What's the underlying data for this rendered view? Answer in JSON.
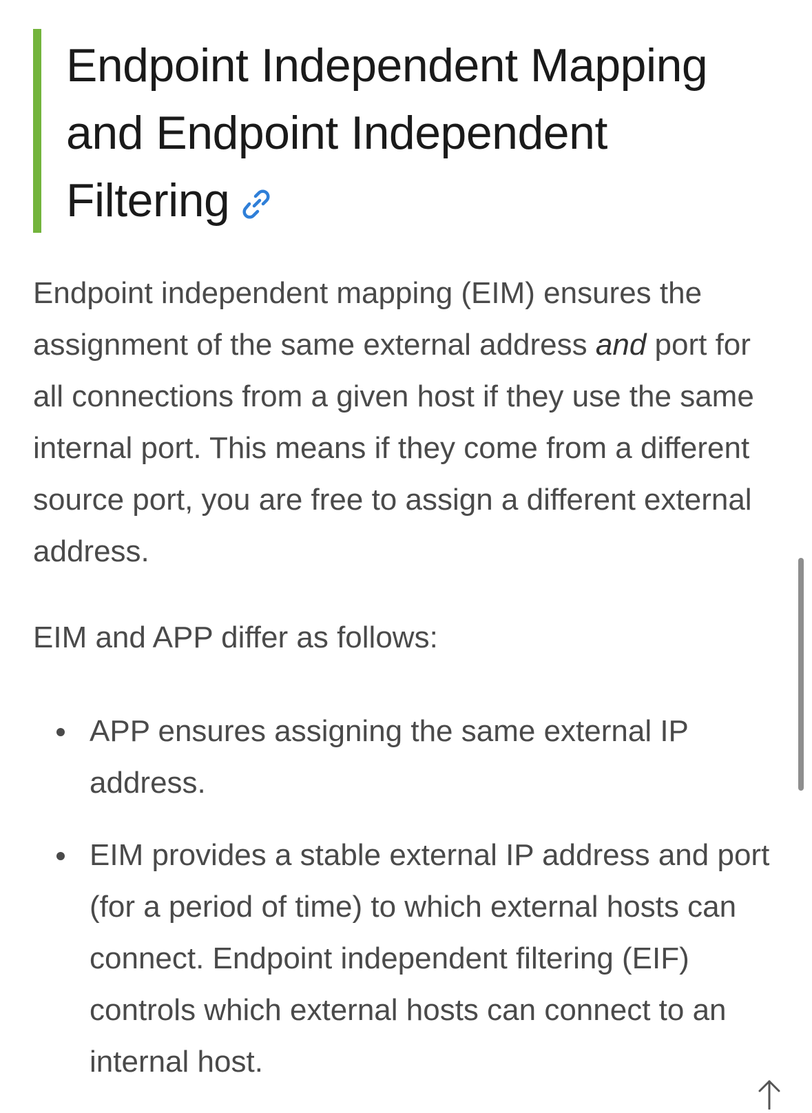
{
  "heading": {
    "title": "Endpoint Independent Mapping and Endpoint Independent Filtering",
    "bar_color": "#73b43c",
    "link_icon": "link-icon"
  },
  "paragraphs": {
    "eim_intro_before": "Endpoint independent mapping (EIM) ensures the assignment of the same external address ",
    "eim_intro_emphasis": "and",
    "eim_intro_after": " port for all connections from a given host if they use the same internal port. This means if they come from a different source port, you are free to assign a different external address.",
    "differ_intro": "EIM and APP differ as follows:"
  },
  "bullets": [
    {
      "text": "APP ensures assigning the same external IP address."
    },
    {
      "text": "EIM provides a stable external IP address and port (for a period of time) to which external hosts can connect. Endpoint independent filtering (EIF) controls which external hosts can connect to an internal host."
    }
  ],
  "controls": {
    "scroll_top_icon": "arrow-up-icon"
  }
}
